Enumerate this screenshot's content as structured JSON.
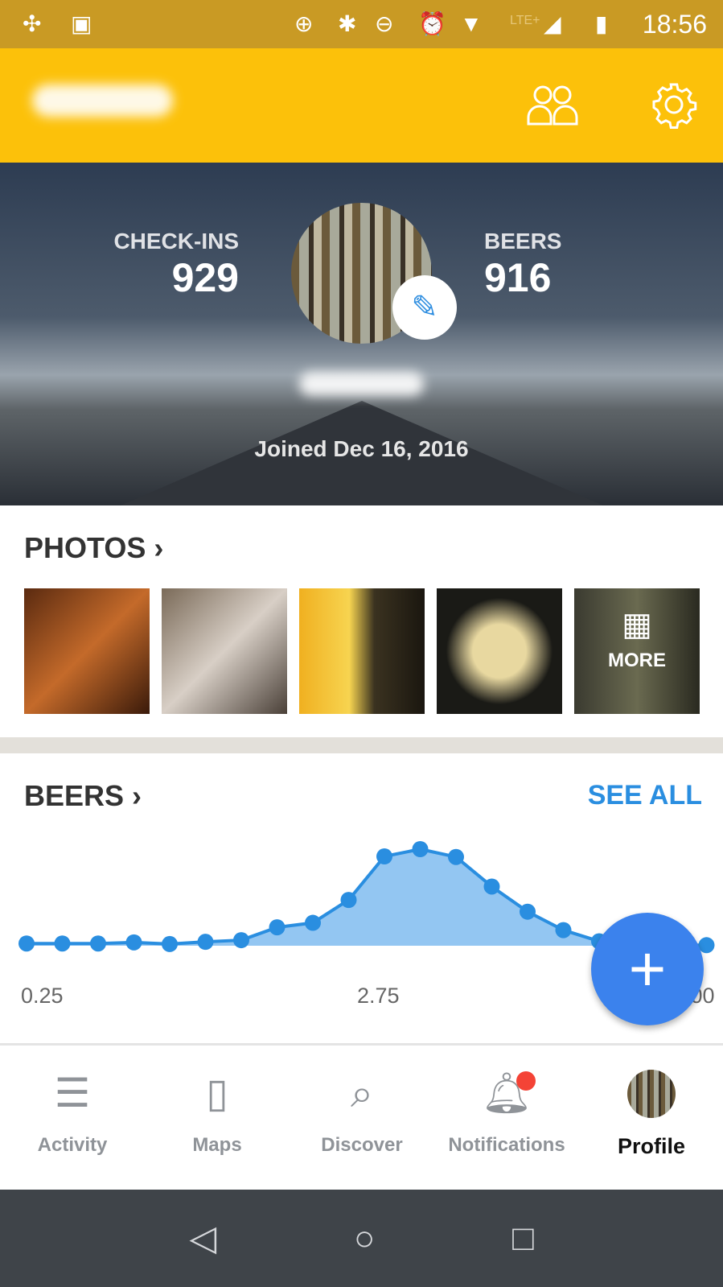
{
  "status_bar": {
    "time": "18:56",
    "network": "LTE+",
    "icons": [
      "pinwheel-icon",
      "image-icon",
      "data-saver-icon",
      "bluetooth-icon",
      "do-not-disturb-icon",
      "alarm-icon",
      "wifi-icon",
      "signal-icon",
      "battery-icon"
    ]
  },
  "app_bar": {
    "icons": [
      "friends-icon",
      "settings-icon"
    ],
    "accent": "#fcc10a"
  },
  "profile": {
    "checkins_label": "CHECK-INS",
    "checkins": "929",
    "beers_label": "BEERS",
    "beers": "916",
    "joined": "Joined Dec 16, 2016"
  },
  "photos": {
    "title": "PHOTOS",
    "more_label": "MORE"
  },
  "beers": {
    "title": "BEERS",
    "see_all": "SEE ALL"
  },
  "chart_data": {
    "type": "area",
    "x": [
      0.25,
      0.5,
      0.75,
      1.0,
      1.25,
      1.5,
      1.75,
      2.0,
      2.25,
      2.5,
      2.75,
      3.0,
      3.25,
      3.5,
      3.75,
      4.0,
      4.25,
      4.5,
      4.75,
      5.0
    ],
    "values": [
      4,
      4,
      4,
      6,
      3,
      7,
      10,
      33,
      41,
      82,
      160,
      173,
      159,
      106,
      61,
      28,
      8,
      3,
      1,
      1
    ],
    "tick_labels": [
      "0.25",
      "2.75",
      "5.00"
    ],
    "color": "#2a8ee0",
    "fill": "#93c6f2",
    "grid": false
  },
  "bottom_nav": {
    "items": [
      {
        "label": "Activity",
        "icon": "list-icon"
      },
      {
        "label": "Maps",
        "icon": "map-icon"
      },
      {
        "label": "Discover",
        "icon": "search-icon"
      },
      {
        "label": "Notifications",
        "icon": "bell-icon"
      },
      {
        "label": "Profile",
        "icon": "avatar"
      }
    ],
    "active": "Profile",
    "badge_color": "#f44336"
  }
}
